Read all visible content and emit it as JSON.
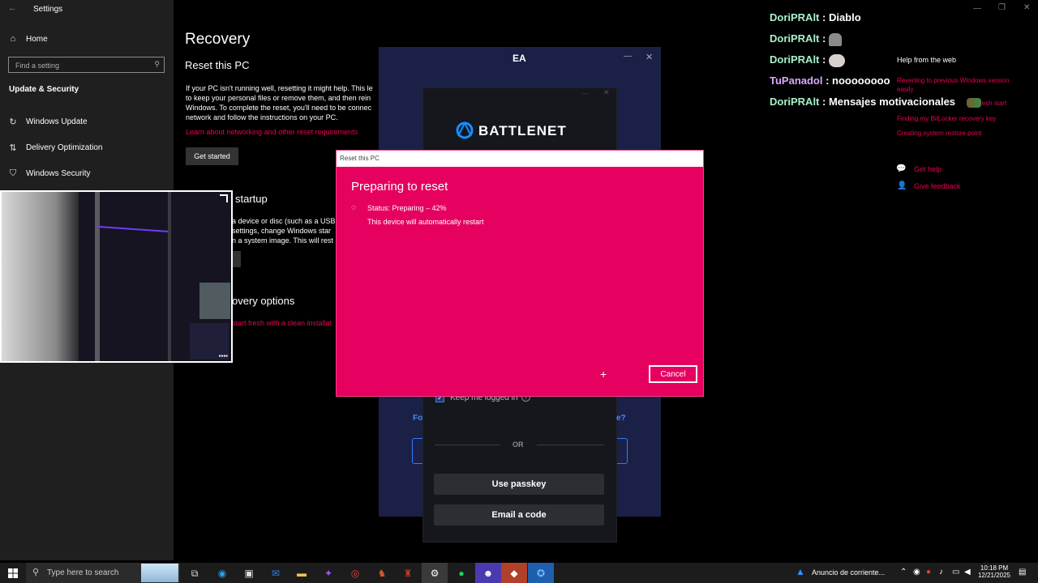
{
  "settings": {
    "window_title": "Settings",
    "nav": {
      "home": "Home",
      "search_placeholder": "Find a setting",
      "section": "Update & Security",
      "items": [
        "Windows Update",
        "Delivery Optimization",
        "Windows Security"
      ]
    },
    "main": {
      "page_title": "Recovery",
      "reset_heading": "Reset this PC",
      "reset_text": "If your PC isn't running well, resetting it might help. This le to keep your personal files or remove them, and then rein Windows. To complete the reset, you'll need to be connec network and follow the instructions on your PC.",
      "reset_link": "Learn about networking and other reset requirements",
      "get_started": "Get started",
      "startup_heading": "startup",
      "startup_text": "a device or disc (such as a USB settings, change Windows star n a system image. This will rest",
      "more_heading": "overy options",
      "more_link": "start fresh with a clean installat"
    },
    "help": {
      "title": "Help from the web",
      "links": [
        "Reverting to previous Windows version easily",
        "resh start",
        "Finding my BitLocker recovery key",
        "Creating system restore point"
      ],
      "get_help": "Get help",
      "give_feedback": "Give feedback"
    }
  },
  "ea": {
    "title": "EA"
  },
  "battlenet": {
    "logo_text": "BATTLENET",
    "keep_logged_in": "Keep me logged in",
    "forgot_left": "Fo",
    "forgot_right": "e?",
    "or": "OR",
    "use_passkey": "Use passkey",
    "email_code": "Email a code"
  },
  "reset_dialog": {
    "titlebar": "Reset this PC",
    "heading": "Preparing to reset",
    "status": "Status: Preparing – 42%",
    "progress_percent": 42,
    "note": "This device will automatically restart",
    "cancel": "Cancel"
  },
  "chat": [
    {
      "user": "DoriPRAlt",
      "message": "Diablo"
    },
    {
      "user": "DoriPRAlt",
      "message": ""
    },
    {
      "user": "DoriPRAlt",
      "message": ""
    },
    {
      "user": "TuPanadol",
      "message": "noooooooo"
    },
    {
      "user": "DoriPRAlt",
      "message": "Mensajes motivacionales"
    }
  ],
  "taskbar": {
    "search_placeholder": "Type here to search",
    "notification": "Anuncio de corriente...",
    "time": "10:18 PM",
    "date": "12/21/2025"
  },
  "colors": {
    "accent": "#e6005f",
    "link": "#e8005a",
    "ea_bg": "#1b2046",
    "bnet_bg": "#15171d"
  }
}
